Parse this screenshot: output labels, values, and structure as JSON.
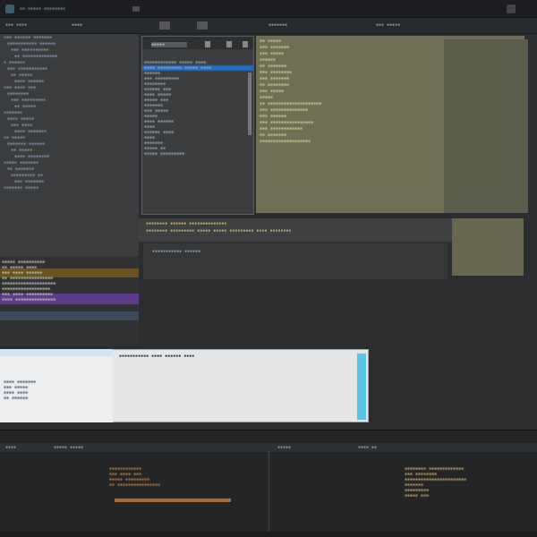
{
  "titlebar": {
    "left_items": [
      "▪▪ ▪▪▪▪▪ ▪▪▪▪▪▪▪▪"
    ],
    "right_items": [
      "▪",
      "▪"
    ]
  },
  "toolbar": {
    "items": [
      "▪▪▪ ▪▪▪▪",
      "▪▪▪▪",
      "▪▪▪▪▪▪▪",
      "▪▪▪ ▪▪▪▪▪"
    ]
  },
  "tree": {
    "lines": [
      "▪▪▪ ▪▪▪▪▪▪ ▪▪▪▪▪▪▪",
      "▪▪▪▪▪▪▪▪▪▪▪ ▪▪▪▪▪▪",
      "▪▪▪ ▪▪▪▪▪▪▪▪▪▪",
      "▪▪ ▪▪▪▪▪▪▪▪▪▪▪▪▪",
      "▪ ▪▪▪▪▪▪",
      "▪▪▪ ▪▪▪▪▪▪▪▪▪▪▪",
      "▪▪ ▪▪▪▪▪",
      "▪▪▪▪ ▪▪▪▪▪▪",
      "▪▪▪ ▪▪▪▪ ▪▪▪",
      "▪▪▪▪▪▪▪▪",
      "▪▪▪ ▪▪▪▪▪▪▪▪▪",
      "▪▪ ▪▪▪▪▪",
      "▪▪▪▪▪▪▪",
      "▪▪▪▪ ▪▪▪▪▪",
      "▪▪▪ ▪▪▪▪",
      "▪▪▪▪ ▪▪▪▪▪▪▪",
      "▪▪ ▪▪▪▪▪",
      "▪▪▪▪▪▪▪ ▪▪▪▪▪▪",
      "▪▪ ▪▪▪▪▪",
      "▪▪▪▪ ▪▪▪▪▪▪▪▪",
      "▪▪▪▪▪ ▪▪▪▪▪▪▪",
      "▪▪ ▪▪▪▪▪▪▪",
      "▪▪▪▪▪▪▪▪▪ ▪▪",
      "▪▪▪ ▪▪▪▪▪▪▪",
      "▪▪▪▪▪▪▪ ▪▪▪▪▪"
    ]
  },
  "list": {
    "title": "▪▪▪▪▪",
    "items": [
      "▪▪▪▪▪▪▪▪▪▪▪▪ ▪▪▪▪▪ ▪▪▪▪",
      "▪▪▪▪ ▪▪▪▪▪▪▪▪▪ ▪▪▪▪▪ ▪▪▪▪",
      "▪▪▪▪▪▪",
      "▪▪▪ ▪▪▪▪▪▪▪▪▪",
      "▪▪▪▪▪▪▪▪",
      "▪▪▪▪▪▪ ▪▪▪",
      "▪▪▪▪ ▪▪▪▪▪",
      "▪▪▪▪▪ ▪▪▪",
      "▪▪▪▪▪▪▪",
      "▪▪▪ ▪▪▪▪▪",
      "▪▪▪▪▪",
      "▪▪▪▪ ▪▪▪▪▪▪",
      "▪▪▪▪",
      "▪▪▪▪▪▪ ▪▪▪▪",
      "▪▪▪▪",
      "▪▪▪▪▪▪▪",
      "▪▪▪▪▪ ▪▪",
      "▪▪▪▪▪ ▪▪▪▪▪▪▪▪▪"
    ],
    "selected_index": 1
  },
  "olive": {
    "lines": [
      "▪▪ ▪▪▪▪▪",
      "▪▪▪ ▪▪▪▪▪▪▪",
      "▪▪▪ ▪▪▪▪▪",
      "▪▪▪▪▪▪",
      "▪▪ ▪▪▪▪▪▪▪",
      "▪▪▪ ▪▪▪▪▪▪▪▪",
      "▪▪▪ ▪▪▪▪▪▪▪",
      "▪▪ ▪▪▪▪▪▪▪▪",
      "▪▪▪ ▪▪▪▪▪",
      "▪▪▪▪▪",
      "▪▪ ▪▪▪▪▪▪▪▪▪▪▪▪▪▪▪▪▪▪▪▪",
      "▪▪▪ ▪▪▪▪▪▪▪▪▪▪▪▪▪▪",
      "▪▪▪ ▪▪▪▪▪▪",
      "▪▪▪ ▪▪▪▪▪▪▪▪▪▪▪▪▪▪▪▪",
      "▪▪▪ ▪▪▪▪▪▪▪▪▪▪▪▪",
      "▪▪ ▪▪▪▪▪▪▪",
      "▪▪▪▪▪▪▪▪▪▪▪▪▪▪▪▪▪▪▪"
    ]
  },
  "mid": {
    "line1": "▪▪▪▪▪▪▪▪ ▪▪▪▪▪▪ ▪▪▪▪▪▪▪▪▪▪▪▪▪▪▪▪",
    "line2": "▪▪▪▪▪▪▪▪ ▪▪▪▪▪▪▪▪▪ ▪▪▪▪▪ ▪▪▪▪▪ ▪▪▪▪▪▪▪▪▪ ▪▪▪▪ ▪▪▪▪▪▪▪▪"
  },
  "output": {
    "lines": [
      "▪▪▪▪▪ ▪▪▪▪▪▪▪▪▪▪",
      "▪▪ ▪▪▪▪▪ ▪▪▪▪",
      "▪▪▪ ▪▪▪▪ ▪▪▪▪▪▪",
      "▪▪ ▪▪▪▪▪▪▪▪▪▪▪▪▪▪▪▪",
      "▪▪▪▪▪▪▪▪▪▪▪▪▪▪▪▪▪▪▪▪",
      "▪▪▪▪▪▪▪▪▪▪▪▪▪▪▪▪▪▪",
      "▪▪▪ ▪▪▪▪ ▪▪▪▪▪▪▪▪▪▪",
      "▪▪▪▪ ▪▪▪▪▪▪▪▪▪▪▪▪▪▪▪"
    ]
  },
  "find": {
    "query": "▪▪▪▪▪▪▪▪▪▪▪ ▪▪▪▪ ▪▪▪▪▪▪ ▪▪▪▪",
    "left_rows": [
      "▪▪▪▪ ▪▪▪▪▪▪▪",
      "▪▪▪ ▪▪▪▪▪",
      "▪▪▪▪ ▪▪▪▪",
      "▪▪ ▪▪▪▪▪▪"
    ],
    "right_rows": [
      "▪▪ ▪▪▪▪▪ ▪▪▪▪▪▪▪▪▪",
      "▪▪▪▪",
      "▪▪▪▪ ▪▪▪▪▪",
      "▪▪▪▪▪ ▪▪▪▪"
    ]
  },
  "bottom": {
    "tabs": [
      "▪▪▪▪",
      "▪▪▪▪▪ ▪▪▪▪▪",
      "▪▪▪▪▪",
      "▪▪▪▪ ▪▪"
    ],
    "left_lines": [
      "▪▪▪▪▪▪▪▪▪▪▪▪",
      "▪▪▪ ▪▪▪▪ ▪▪▪",
      "▪▪▪▪▪ ▪▪▪▪▪▪▪▪▪",
      "▪▪ ▪▪▪▪▪▪▪▪▪▪▪▪▪▪▪▪"
    ],
    "right_lines": [
      "▪▪▪▪▪▪▪▪ ▪▪▪▪▪▪▪▪▪▪▪▪▪",
      "▪▪▪ ▪▪▪▪▪▪▪▪",
      "▪▪▪▪▪▪▪▪▪▪▪▪▪▪▪▪▪▪▪▪▪▪▪",
      "▪▪▪▪▪▪▪",
      "▪▪▪▪▪▪▪▪▪",
      "▪▪▪▪▪ ▪▪▪"
    ]
  },
  "colors": {
    "accent": "#1e6fc7",
    "olive": "#6f6f56",
    "orange": "#d07a2a",
    "purple": "#7a4ca6",
    "cyan": "#58c6e8"
  }
}
